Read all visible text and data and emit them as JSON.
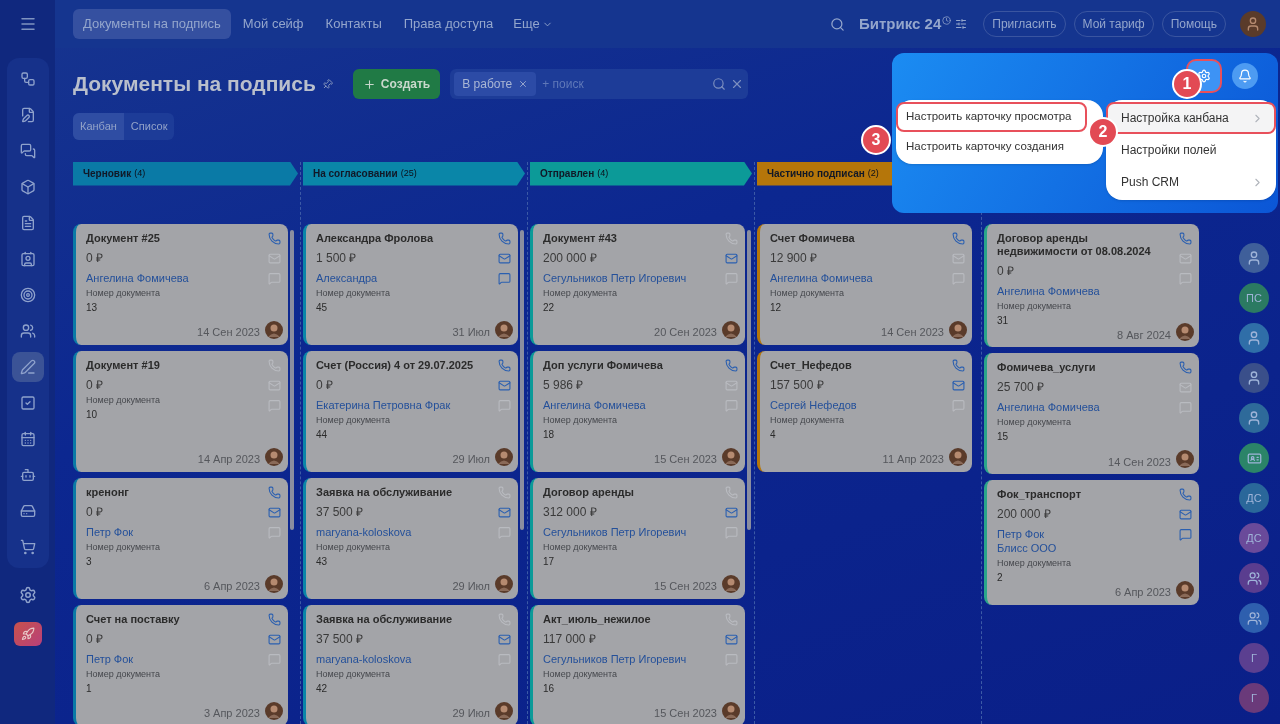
{
  "top_nav": {
    "items": [
      {
        "label": "Документы на подпись",
        "selected": true
      },
      {
        "label": "Мой сейф",
        "selected": false
      },
      {
        "label": "Контакты",
        "selected": false
      },
      {
        "label": "Права доступа",
        "selected": false
      }
    ],
    "more": "Еще",
    "brand": "Битрикс 24",
    "buttons": [
      "Пригласить",
      "Мой тариф",
      "Помощь"
    ]
  },
  "sidebar": {
    "items": [
      {
        "kind": "workflow",
        "selected": false
      },
      {
        "kind": "doc-edit",
        "selected": false
      },
      {
        "kind": "chat",
        "selected": false
      },
      {
        "kind": "box",
        "selected": false
      },
      {
        "kind": "document",
        "selected": false
      },
      {
        "kind": "contact",
        "selected": false
      },
      {
        "kind": "target",
        "selected": false
      },
      {
        "kind": "users",
        "selected": false
      },
      {
        "kind": "pen",
        "selected": true
      },
      {
        "kind": "task",
        "selected": false
      },
      {
        "kind": "calendar",
        "selected": false
      },
      {
        "kind": "bot",
        "selected": false
      },
      {
        "kind": "drive",
        "selected": false
      },
      {
        "kind": "cart",
        "selected": false
      }
    ]
  },
  "header": {
    "title": "Документы на подпись",
    "create_button": "Создать",
    "filter_chip": "В работе",
    "search_placeholder": "+ поиск"
  },
  "view_tabs": [
    {
      "label": "Канбан",
      "selected": true
    },
    {
      "label": "Список",
      "selected": false
    }
  ],
  "columns": [
    {
      "title": "Черновик",
      "count": "(4)",
      "color": "#0a7aa6",
      "cards": [
        {
          "title": "Документ #25",
          "amount": "0 ₽",
          "contacts": [
            "Ангелина Фомичева"
          ],
          "doc_label": "Номер документа",
          "doc_number": "13",
          "date": "14 Сен 2023",
          "phone": true,
          "mail": false,
          "chat": false
        },
        {
          "title": "Документ #19",
          "amount": "0 ₽",
          "doc_label": "Номер документа",
          "doc_number": "10",
          "date": "14 Апр 2023",
          "phone": false,
          "mail": false,
          "chat": false
        },
        {
          "title": "кренонг",
          "amount": "0 ₽",
          "contacts": [
            "Петр Фок"
          ],
          "doc_label": "Номер документа",
          "doc_number": "3",
          "date": "6 Апр 2023",
          "phone": true,
          "mail": true,
          "chat": false
        },
        {
          "title": "Счет на поставку",
          "amount": "0 ₽",
          "contacts": [
            "Петр Фок"
          ],
          "doc_label": "Номер документа",
          "doc_number": "1",
          "date": "3 Апр 2023",
          "phone": true,
          "mail": true,
          "chat": false
        }
      ]
    },
    {
      "title": "На согласовании",
      "count": "(25)",
      "color": "#0a86a8",
      "cards": [
        {
          "title": "Александра Фролова",
          "amount": "1 500 ₽",
          "contacts": [
            "Александра"
          ],
          "doc_label": "Номер документа",
          "doc_number": "45",
          "date": "31 Июл",
          "phone": true,
          "mail": true,
          "chat": true
        },
        {
          "title": "Счет (Россия) 4 от 29.07.2025",
          "amount": "0 ₽",
          "contacts": [
            "Екатерина Петровна Фрак"
          ],
          "doc_label": "Номер документа",
          "doc_number": "44",
          "date": "29 Июл",
          "phone": true,
          "mail": true,
          "chat": false
        },
        {
          "title": "Заявка на обслуживание",
          "amount": "37 500 ₽",
          "contacts": [
            "maryana-koloskova"
          ],
          "doc_label": "Номер документа",
          "doc_number": "43",
          "date": "29 Июл",
          "phone": false,
          "mail": true,
          "chat": false
        },
        {
          "title": "Заявка на обслуживание",
          "amount": "37 500 ₽",
          "contacts": [
            "maryana-koloskova"
          ],
          "doc_label": "Номер документа",
          "doc_number": "42",
          "date": "29 Июл",
          "phone": false,
          "mail": true,
          "chat": false
        }
      ]
    },
    {
      "title": "Отправлен",
      "count": "(4)",
      "color": "#0c9a98",
      "cards": [
        {
          "title": "Документ #43",
          "amount": "200 000 ₽",
          "contacts": [
            "Сегульников Петр Игоревич"
          ],
          "doc_label": "Номер документа",
          "doc_number": "22",
          "date": "20 Сен 2023",
          "phone": false,
          "mail": true,
          "chat": false
        },
        {
          "title": "Доп услуги Фомичева",
          "amount": "5 986 ₽",
          "contacts": [
            "Ангелина Фомичева"
          ],
          "doc_label": "Номер документа",
          "doc_number": "18",
          "date": "15 Сен 2023",
          "phone": true,
          "mail": false,
          "chat": false
        },
        {
          "title": "Договор аренды",
          "amount": "312 000 ₽",
          "contacts": [
            "Сегульников Петр Игоревич"
          ],
          "doc_label": "Номер документа",
          "doc_number": "17",
          "date": "15 Сен 2023",
          "phone": false,
          "mail": true,
          "chat": false
        },
        {
          "title": "Акт_июль_нежилое",
          "amount": "117 000 ₽",
          "contacts": [
            "Сегульников Петр Игоревич"
          ],
          "doc_label": "Номер документа",
          "doc_number": "16",
          "date": "15 Сен 2023",
          "phone": false,
          "mail": true,
          "chat": false
        }
      ]
    },
    {
      "title": "Частично подписан",
      "count": "(2)",
      "color": "#b5760a",
      "cards": [
        {
          "title": "Счет Фомичева",
          "amount": "12 900 ₽",
          "contacts": [
            "Ангелина Фомичева"
          ],
          "doc_label": "Номер документа",
          "doc_number": "12",
          "date": "14 Сен 2023",
          "phone": true,
          "mail": false,
          "chat": false
        },
        {
          "title": "Счет_Нефедов",
          "amount": "157 500 ₽",
          "contacts": [
            "Сергей Нефедов"
          ],
          "doc_label": "Номер документа",
          "doc_number": "4",
          "date": "11 Апр 2023",
          "phone": true,
          "mail": true,
          "chat": false
        }
      ]
    },
    {
      "color": "#2aa58a",
      "cards": [
        {
          "title": "Договор аренды недвижимости от 08.08.2024",
          "amount": "0 ₽",
          "contacts": [
            "Ангелина Фомичева"
          ],
          "doc_label": "Номер документа",
          "doc_number": "31",
          "date": "8 Авг 2024",
          "phone": true,
          "mail": false,
          "chat": false
        },
        {
          "title": "Фомичева_услуги",
          "amount": "25 700 ₽",
          "contacts": [
            "Ангелина Фомичева"
          ],
          "doc_label": "Номер документа",
          "doc_number": "15",
          "date": "14 Сен 2023",
          "phone": true,
          "mail": false,
          "chat": false
        },
        {
          "title": "Фок_транспорт",
          "amount": "200 000 ₽",
          "contacts": [
            "Петр Фок",
            "Блисс ООО"
          ],
          "doc_label": "Номер документа",
          "doc_number": "2",
          "date": "6 Апр 2023",
          "phone": true,
          "mail": true,
          "chat": true
        }
      ]
    }
  ],
  "right_strip": [
    {
      "kind": "avatar",
      "color": "#3f5f9a"
    },
    {
      "kind": "initials",
      "text": "ПС",
      "color": "#2b7a62"
    },
    {
      "kind": "avatar",
      "color": "#2f6ea8"
    },
    {
      "kind": "avatar",
      "color": "#3a4f8a"
    },
    {
      "kind": "avatar",
      "color": "#2e6a9a"
    },
    {
      "kind": "card",
      "color": "#2b8468"
    },
    {
      "kind": "initials",
      "text": "ДС",
      "color": "#2a679a"
    },
    {
      "kind": "initials",
      "text": "ДС",
      "color": "#6a4a9a"
    },
    {
      "kind": "group",
      "color": "#5a3d8f"
    },
    {
      "kind": "group",
      "color": "#2e5fae"
    },
    {
      "kind": "initials",
      "text": "Г",
      "color": "#5b3f90"
    },
    {
      "kind": "initials",
      "text": "Г",
      "color": "#6a3a7a"
    }
  ],
  "settings_popup": {
    "menu": [
      {
        "label": "Настройка канбана",
        "submenu": true,
        "highlighted": true
      },
      {
        "label": "Настройки полей",
        "submenu": false,
        "highlighted": false
      },
      {
        "label": "Push CRM",
        "submenu": true,
        "highlighted": false
      }
    ],
    "submenu": [
      {
        "label": "Настроить карточку просмотра",
        "highlighted": true
      },
      {
        "label": "Настроить карточку создания",
        "highlighted": false
      }
    ],
    "gear_highlighted": true,
    "callouts": [
      "1",
      "2",
      "3"
    ]
  }
}
